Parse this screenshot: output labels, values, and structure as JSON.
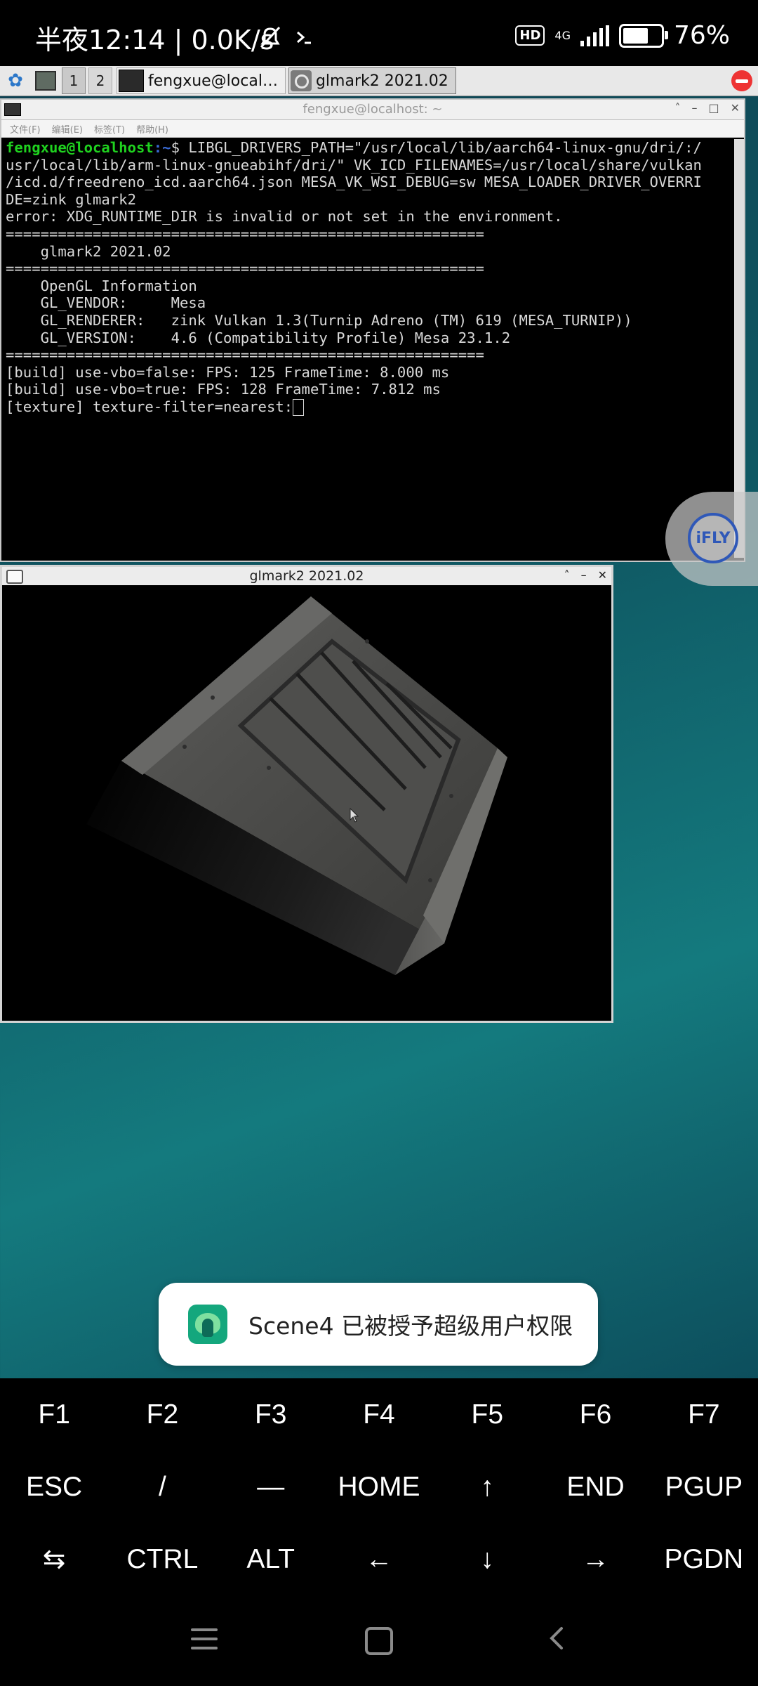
{
  "status_bar": {
    "time": "半夜12:14 | 0.0K/s",
    "hd": "HD",
    "network": "4G",
    "battery": "76%",
    "battery_level": 0.76
  },
  "panel": {
    "workspaces": [
      "1",
      "2"
    ],
    "tasks": [
      {
        "label": "fengxue@local…",
        "icon": "terminal-icon"
      },
      {
        "label": "glmark2 2021.02",
        "icon": "gear-icon"
      }
    ]
  },
  "terminal": {
    "title": "fengxue@localhost: ~",
    "menu": [
      "文件(F)",
      "编辑(E)",
      "标签(T)",
      "帮助(H)"
    ],
    "prompt_user": "fengxue@localhost",
    "prompt_path": ":~",
    "prompt_symbol": "$ ",
    "command_line1": "LIBGL_DRIVERS_PATH=\"/usr/local/lib/aarch64-linux-gnu/dri/:/",
    "lines": [
      "usr/local/lib/arm-linux-gnueabihf/dri/\" VK_ICD_FILENAMES=/usr/local/share/vulkan",
      "/icd.d/freedreno_icd.aarch64.json MESA_VK_WSI_DEBUG=sw MESA_LOADER_DRIVER_OVERRI",
      "DE=zink glmark2",
      "error: XDG_RUNTIME_DIR is invalid or not set in the environment.",
      "=======================================================",
      "    glmark2 2021.02",
      "=======================================================",
      "    OpenGL Information",
      "    GL_VENDOR:     Mesa",
      "    GL_RENDERER:   zink Vulkan 1.3(Turnip Adreno (TM) 619 (MESA_TURNIP))",
      "    GL_VERSION:    4.6 (Compatibility Profile) Mesa 23.1.2",
      "=======================================================",
      "[build] use-vbo=false: FPS: 125 FrameTime: 8.000 ms",
      "[build] use-vbo=true: FPS: 128 FrameTime: 7.812 ms"
    ],
    "last_line": "[texture] texture-filter=nearest:"
  },
  "ifly": {
    "label": "iFLY"
  },
  "glmark_window": {
    "title": "glmark2 2021.02"
  },
  "toast": {
    "message": "Scene4 已被授予超级用户权限"
  },
  "keys": {
    "row1": [
      "F1",
      "F2",
      "F3",
      "F4",
      "F5",
      "F6",
      "F7"
    ],
    "row2": [
      "ESC",
      "/",
      "—",
      "HOME",
      "↑",
      "END",
      "PGUP"
    ],
    "row3": [
      "⇆",
      "CTRL",
      "ALT",
      "←",
      "↓",
      "→",
      "PGDN"
    ]
  }
}
